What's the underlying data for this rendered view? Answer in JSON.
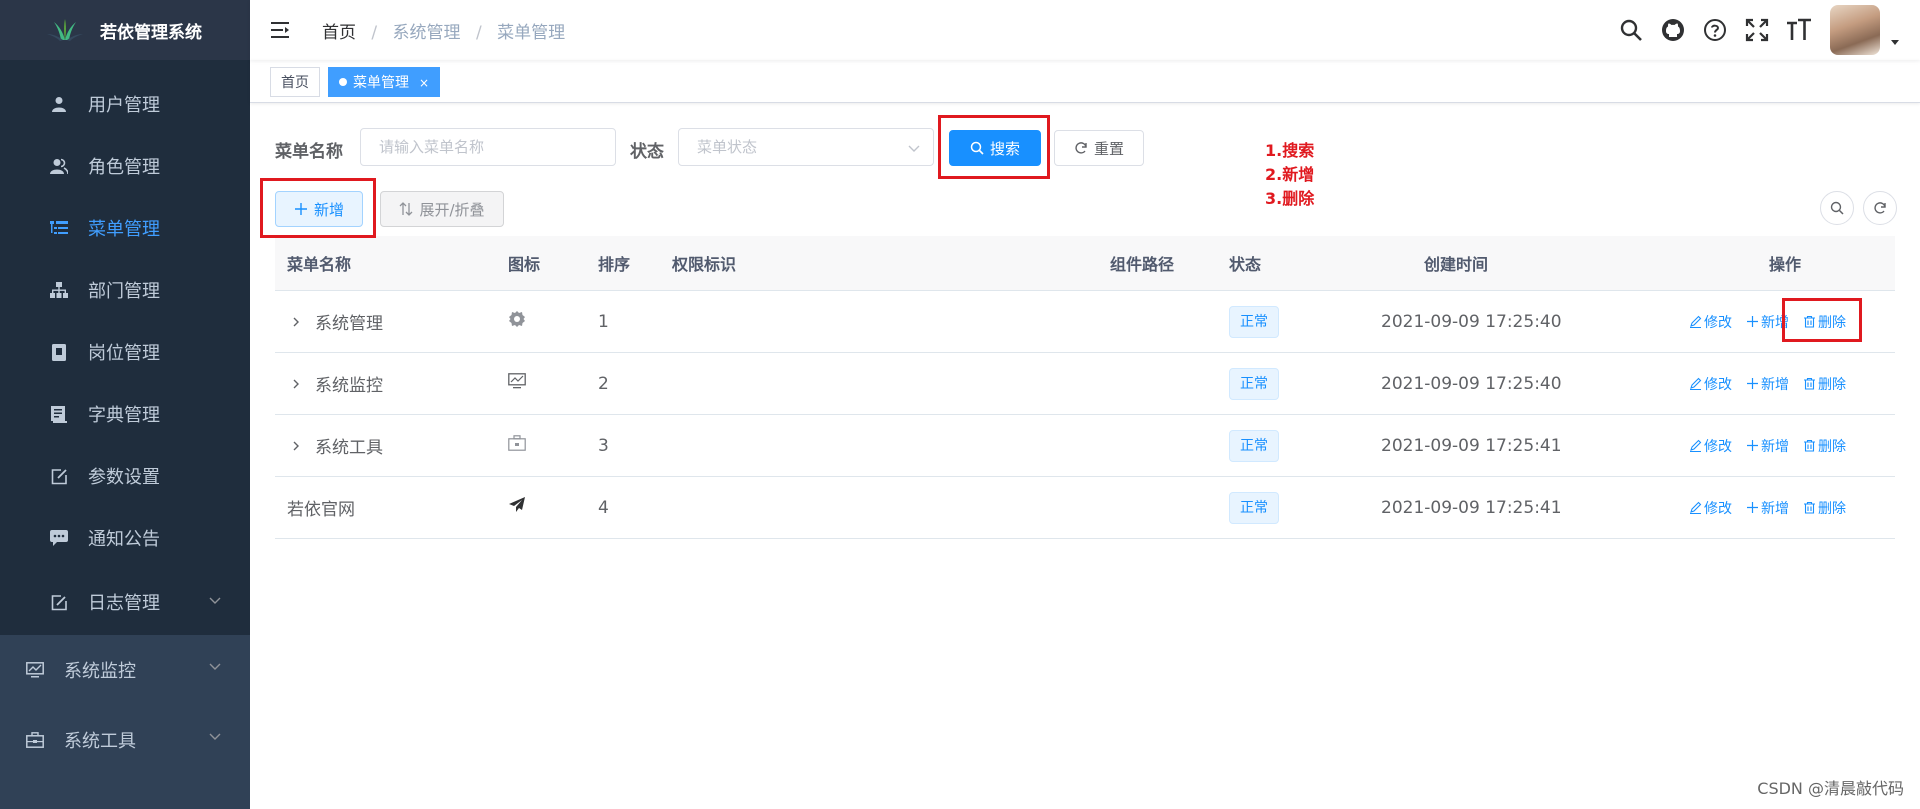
{
  "app": {
    "title": "若依管理系统"
  },
  "sidebar": {
    "submenu_items": [
      {
        "label": "用户管理",
        "icon": "user-icon"
      },
      {
        "label": "角色管理",
        "icon": "peoples-icon"
      },
      {
        "label": "菜单管理",
        "icon": "tree-table-icon",
        "active": true
      },
      {
        "label": "部门管理",
        "icon": "tree-icon"
      },
      {
        "label": "岗位管理",
        "icon": "post-icon"
      },
      {
        "label": "字典管理",
        "icon": "dict-icon"
      },
      {
        "label": "参数设置",
        "icon": "edit-icon"
      },
      {
        "label": "通知公告",
        "icon": "message-icon"
      },
      {
        "label": "日志管理",
        "icon": "log-icon"
      }
    ],
    "top_items": [
      {
        "label": "系统监控",
        "icon": "monitor-icon"
      },
      {
        "label": "系统工具",
        "icon": "tool-icon"
      }
    ]
  },
  "breadcrumb": {
    "home": "首页",
    "level1": "系统管理",
    "level2": "菜单管理"
  },
  "tags": {
    "home": "首页",
    "current": "菜单管理",
    "close": "×"
  },
  "search": {
    "menu_name_label": "菜单名称",
    "menu_name_placeholder": "请输入菜单名称",
    "status_label": "状态",
    "status_placeholder": "菜单状态",
    "search_button": "搜索",
    "reset_button": "重置"
  },
  "toolbar": {
    "add_button": "新增",
    "expand_button": "展开/折叠"
  },
  "annotation": {
    "line1": "1.搜索",
    "line2": "2.新增",
    "line3": "3.删除"
  },
  "table": {
    "headers": {
      "name": "菜单名称",
      "icon": "图标",
      "order": "排序",
      "perm": "权限标识",
      "component": "组件路径",
      "status": "状态",
      "created": "创建时间",
      "actions": "操作"
    },
    "rows": [
      {
        "name": "系统管理",
        "icon": "system-icon",
        "order": "1",
        "perm": "",
        "component": "",
        "status": "正常",
        "created": "2021-09-09 17:25:40",
        "expandable": true
      },
      {
        "name": "系统监控",
        "icon": "monitor-icon",
        "order": "2",
        "perm": "",
        "component": "",
        "status": "正常",
        "created": "2021-09-09 17:25:40",
        "expandable": true
      },
      {
        "name": "系统工具",
        "icon": "tool-icon",
        "order": "3",
        "perm": "",
        "component": "",
        "status": "正常",
        "created": "2021-09-09 17:25:41",
        "expandable": true
      },
      {
        "name": "若依官网",
        "icon": "guide-icon",
        "order": "4",
        "perm": "",
        "component": "",
        "status": "正常",
        "created": "2021-09-09 17:25:41",
        "expandable": false
      }
    ],
    "actions": {
      "edit": "修改",
      "add": "新增",
      "delete": "删除"
    }
  },
  "watermark": "CSDN @清晨敲代码",
  "colors": {
    "sidebar": "#304156",
    "submenu": "#1f2d3d",
    "primary": "#1890ff",
    "highlight": "#e0191f"
  }
}
